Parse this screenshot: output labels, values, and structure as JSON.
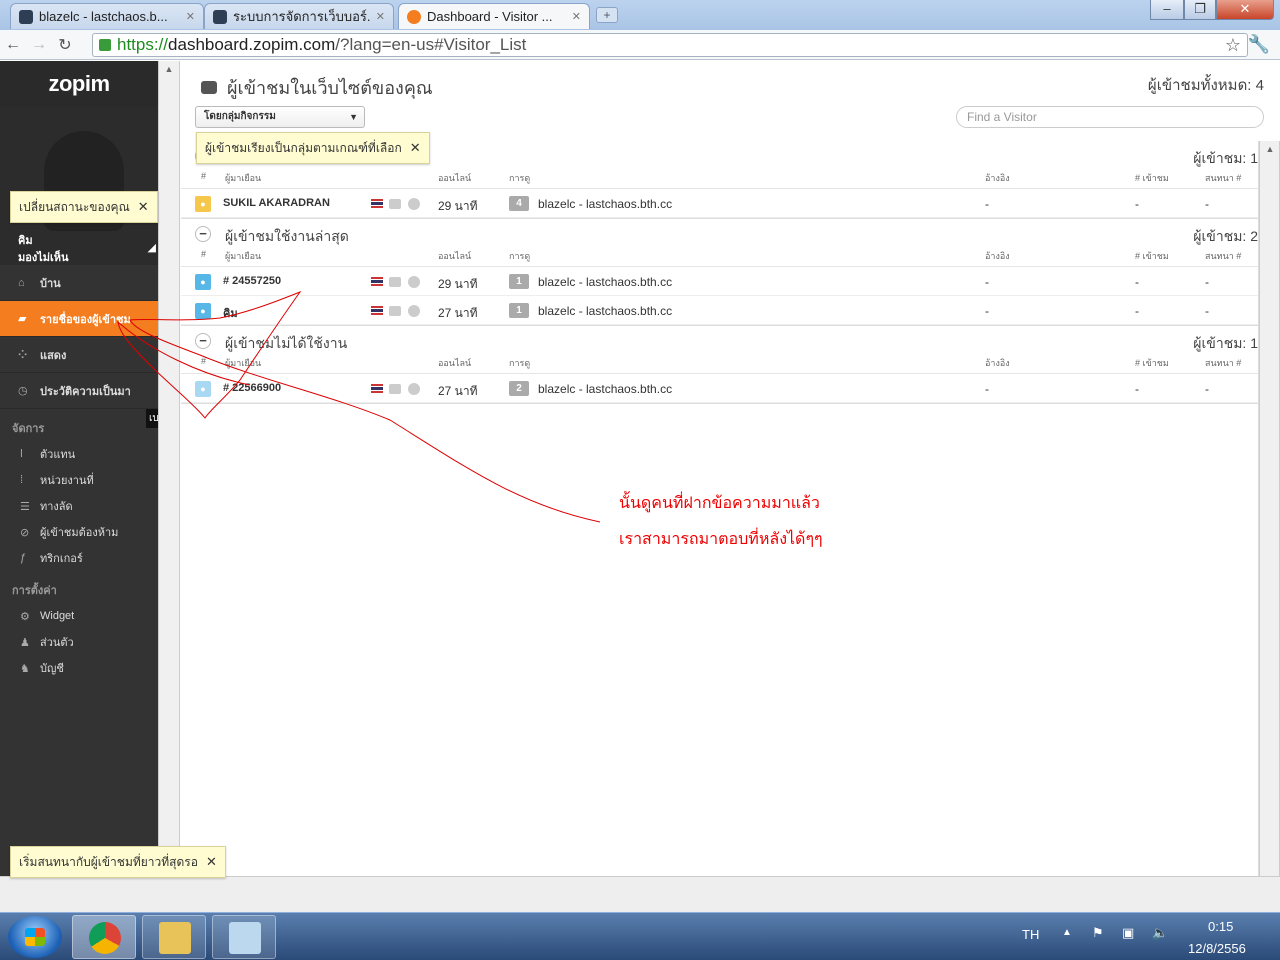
{
  "browser": {
    "tabs": [
      {
        "label": "blazelc - lastchaos.b..."
      },
      {
        "label": "ระบบการจัดการเว็บบอร์..."
      },
      {
        "label": "Dashboard - Visitor ..."
      }
    ],
    "url_scheme": "https://",
    "url_host": "dashboard.zopim.com",
    "url_path": "/?lang=en-us#Visitor_List"
  },
  "sidebar": {
    "logo": "zopim",
    "user_name": "คิม",
    "user_status": "มองไม่เห็น",
    "status_tip": "เปลี่ยนสถานะของคุณ",
    "nav": [
      {
        "label": "บ้าน",
        "icon": "home-icon"
      },
      {
        "label": "รายชื่อของผู้เข้าชม",
        "icon": "chat-bubble-icon"
      },
      {
        "label": "แสดง",
        "icon": "dots-icon"
      },
      {
        "label": "ประวัติความเป็นมา",
        "icon": "clock-icon"
      }
    ],
    "manage_heading": "จัดการ",
    "manage_items": [
      {
        "label": "ตัวแทน",
        "icon": "agent-icon"
      },
      {
        "label": "หน่วยงานที่",
        "icon": "department-icon"
      },
      {
        "label": "ทางลัด",
        "icon": "shortcut-icon"
      },
      {
        "label": "ผู้เข้าชมต้องห้าม",
        "icon": "ban-icon"
      },
      {
        "label": "ทริกเกอร์",
        "icon": "trigger-icon"
      }
    ],
    "settings_heading": "การตั้งค่า",
    "settings_items": [
      {
        "label": "Widget",
        "icon": "gear-icon"
      },
      {
        "label": "ส่วนตัว",
        "icon": "person-icon"
      },
      {
        "label": "บัญชี",
        "icon": "account-icon"
      }
    ],
    "side_tooltip": "เบ",
    "bottom_tip": "เริ่มสนทนากับผู้เข้าชมที่ยาวที่สุดรอ"
  },
  "main": {
    "title": "ผู้เข้าชมในเว็บไซต์ของคุณ",
    "total": "ผู้เข้าชมทั้งหมด: 4",
    "group_select": "โดยกลุ่มกิจกรรม",
    "group_tip": "ผู้เข้าชมเรียงเป็นกลุ่มตามเกณฑ์ที่เลือก",
    "find_placeholder": "Find a Visitor",
    "columns": {
      "num": "#",
      "visitor": "ผู้มาเยือน",
      "online": "ออนไลน์",
      "visits": "การดู",
      "referrer": "อ้างอิง",
      "visits_num": "# เข้าชม",
      "chats_num": "สนทนา #"
    },
    "sections": [
      {
        "title": "",
        "count": "ผู้เข้าชม: 1",
        "rows": [
          {
            "name": "SUKIL AKARADRAN",
            "online": "29 นาที",
            "views": "4",
            "page": "blazelc - lastchaos.bth.cc",
            "referrer": "-",
            "visits": "-",
            "chats": "-"
          }
        ]
      },
      {
        "title": "ผู้เข้าชมใช้งานล่าสุด",
        "count": "ผู้เข้าชม: 2",
        "rows": [
          {
            "name": "# 24557250",
            "online": "29 นาที",
            "views": "1",
            "page": "blazelc - lastchaos.bth.cc",
            "referrer": "-",
            "visits": "-",
            "chats": "-"
          },
          {
            "name": "คิม",
            "online": "27 นาที",
            "views": "1",
            "page": "blazelc - lastchaos.bth.cc",
            "referrer": "-",
            "visits": "-",
            "chats": "-"
          }
        ]
      },
      {
        "title": "ผู้เข้าชมไม่ได้ใช้งาน",
        "count": "ผู้เข้าชม: 1",
        "rows": [
          {
            "name": "# 22566900",
            "online": "27 นาที",
            "views": "2",
            "page": "blazelc - lastchaos.bth.cc",
            "referrer": "-",
            "visits": "-",
            "chats": "-"
          }
        ]
      }
    ],
    "annotation_line1": "นั้นดูคนที่ฝากข้อความมาแล้ว",
    "annotation_line2": "เราสามารถมาตอบที่หลังได้ๆๆ"
  },
  "taskbar": {
    "lang": "TH",
    "time": "0:15",
    "date": "12/8/2556"
  },
  "colors": {
    "accent": "#f47d20",
    "sidebar": "#333333",
    "annotation": "#e00000"
  }
}
